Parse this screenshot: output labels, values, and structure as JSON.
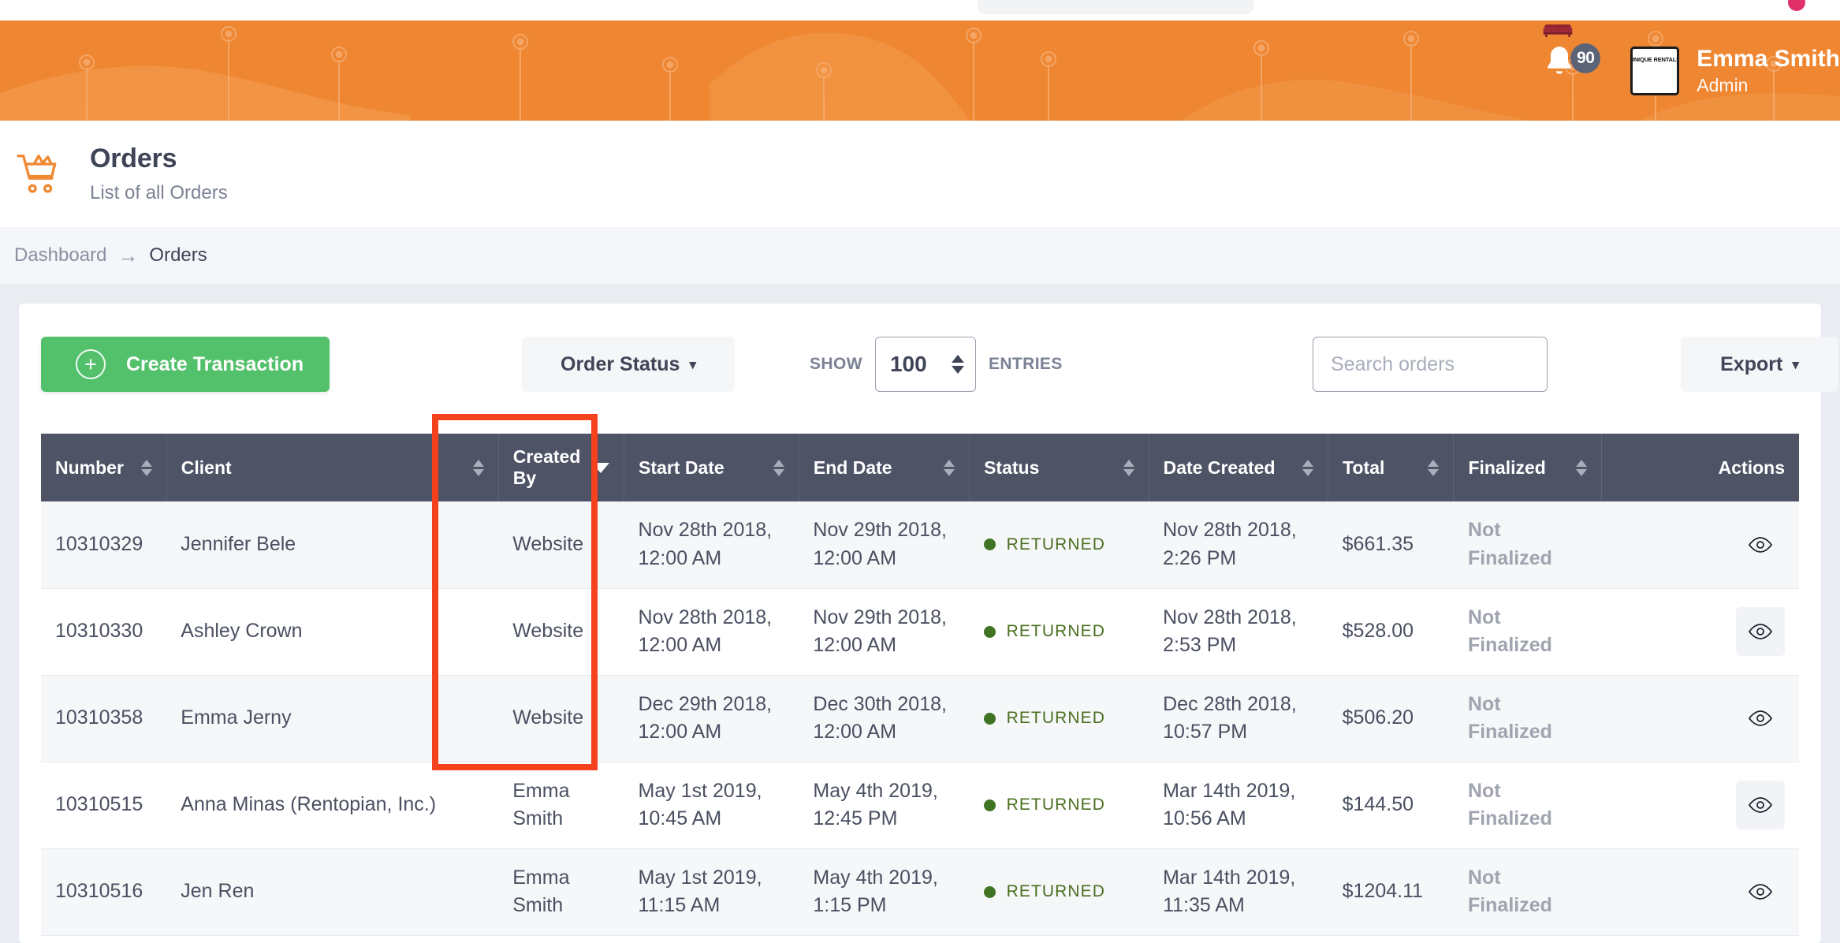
{
  "header": {
    "notifications_count": "90",
    "avatar_brand": "UNIQUE RENTALS",
    "user_name": "Emma Smith",
    "user_role": "Admin"
  },
  "page": {
    "title": "Orders",
    "subtitle": "List of all Orders"
  },
  "breadcrumb": {
    "root": "Dashboard",
    "arrow": "→",
    "current": "Orders"
  },
  "toolbar": {
    "create_label": "Create Transaction",
    "create_plus": "+",
    "order_status_label": "Order Status",
    "show_label": "SHOW",
    "entries_value": "100",
    "entries_label": "ENTRIES",
    "search_placeholder": "Search orders",
    "search_value": "",
    "export_label": "Export",
    "caret": "▾"
  },
  "table": {
    "columns": [
      {
        "label": "Number",
        "sortable": true,
        "active_sort": false
      },
      {
        "label": "Client",
        "sortable": true,
        "active_sort": false
      },
      {
        "label": "Created By",
        "sortable": true,
        "active_sort": true
      },
      {
        "label": "Start Date",
        "sortable": true,
        "active_sort": false
      },
      {
        "label": "End Date",
        "sortable": true,
        "active_sort": false
      },
      {
        "label": "Status",
        "sortable": true,
        "active_sort": false
      },
      {
        "label": "Date Created",
        "sortable": true,
        "active_sort": false
      },
      {
        "label": "Total",
        "sortable": true,
        "active_sort": false
      },
      {
        "label": "Finalized",
        "sortable": true,
        "active_sort": false
      },
      {
        "label": "Actions",
        "sortable": false,
        "active_sort": false
      }
    ],
    "rows": [
      {
        "number": "10310329",
        "client": "Jennifer Bele",
        "created_by": "Website",
        "start_date": "Nov 28th 2018, 12:00 AM",
        "end_date": "Nov 29th 2018, 12:00 AM",
        "status": "RETURNED",
        "date_created": "Nov 28th 2018, 2:26 PM",
        "total": "$661.35",
        "finalized": "Not Finalized"
      },
      {
        "number": "10310330",
        "client": "Ashley Crown",
        "created_by": "Website",
        "start_date": "Nov 28th 2018, 12:00 AM",
        "end_date": "Nov 29th 2018, 12:00 AM",
        "status": "RETURNED",
        "date_created": "Nov 28th 2018, 2:53 PM",
        "total": "$528.00",
        "finalized": "Not Finalized"
      },
      {
        "number": "10310358",
        "client": "Emma Jerny",
        "created_by": "Website",
        "start_date": "Dec 29th 2018, 12:00 AM",
        "end_date": "Dec 30th 2018, 12:00 AM",
        "status": "RETURNED",
        "date_created": "Dec 28th 2018, 10:57 PM",
        "total": "$506.20",
        "finalized": "Not Finalized"
      },
      {
        "number": "10310515",
        "client": "Anna Minas (Rentopian, Inc.)",
        "created_by": "Emma Smith",
        "start_date": "May 1st 2019, 10:45 AM",
        "end_date": "May 4th 2019, 12:45 PM",
        "status": "RETURNED",
        "date_created": "Mar 14th 2019, 10:56 AM",
        "total": "$144.50",
        "finalized": "Not Finalized"
      },
      {
        "number": "10310516",
        "client": "Jen Ren",
        "created_by": "Emma Smith",
        "start_date": "May 1st 2019, 11:15 AM",
        "end_date": "May 4th 2019, 1:15 PM",
        "status": "RETURNED",
        "date_created": "Mar 14th 2019, 11:35 AM",
        "total": "$1204.11",
        "finalized": "Not Finalized"
      }
    ]
  },
  "annotation": {
    "highlight_column": "Created By",
    "color": "#f4411e"
  },
  "colors": {
    "brand_orange": "#ee8632",
    "header_dark": "#4e5366",
    "create_green": "#53c06c",
    "status_green": "#4a6e1e",
    "annotation_red": "#f4411e"
  }
}
